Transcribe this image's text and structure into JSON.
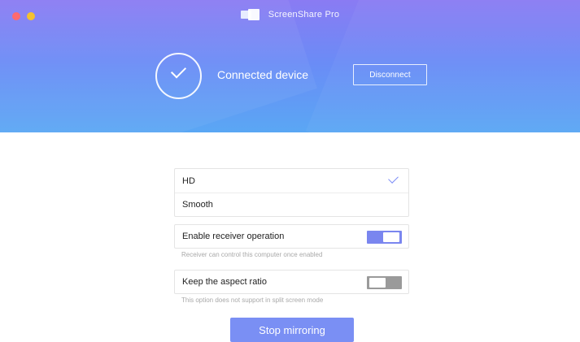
{
  "window": {
    "title": "ScreenShare Pro"
  },
  "header": {
    "status_text": "Connected device",
    "disconnect_label": "Disconnect"
  },
  "quality": {
    "options": [
      {
        "label": "HD",
        "selected": true
      },
      {
        "label": "Smooth",
        "selected": false
      }
    ]
  },
  "settings": {
    "receiver_operation": {
      "label": "Enable receiver operation",
      "enabled": true,
      "caption": "Receiver can control this computer once enabled"
    },
    "aspect_ratio": {
      "label": "Keep the aspect ratio",
      "enabled": false,
      "caption": "This option does not support in split screen mode"
    }
  },
  "actions": {
    "stop_label": "Stop mirroring"
  },
  "colors": {
    "accent": "#7a8ff4",
    "toggle_on": "#7a86ef",
    "toggle_off": "#9a9a9a",
    "header_gradient_top": "#8a7bf3",
    "header_gradient_bottom": "#5aa7f4",
    "close_button": "#fe6a6d",
    "minimize_button": "#f4c12e"
  },
  "icons": {
    "app": "screen-share-icon",
    "status": "check-circle-icon",
    "selection": "check-icon"
  }
}
